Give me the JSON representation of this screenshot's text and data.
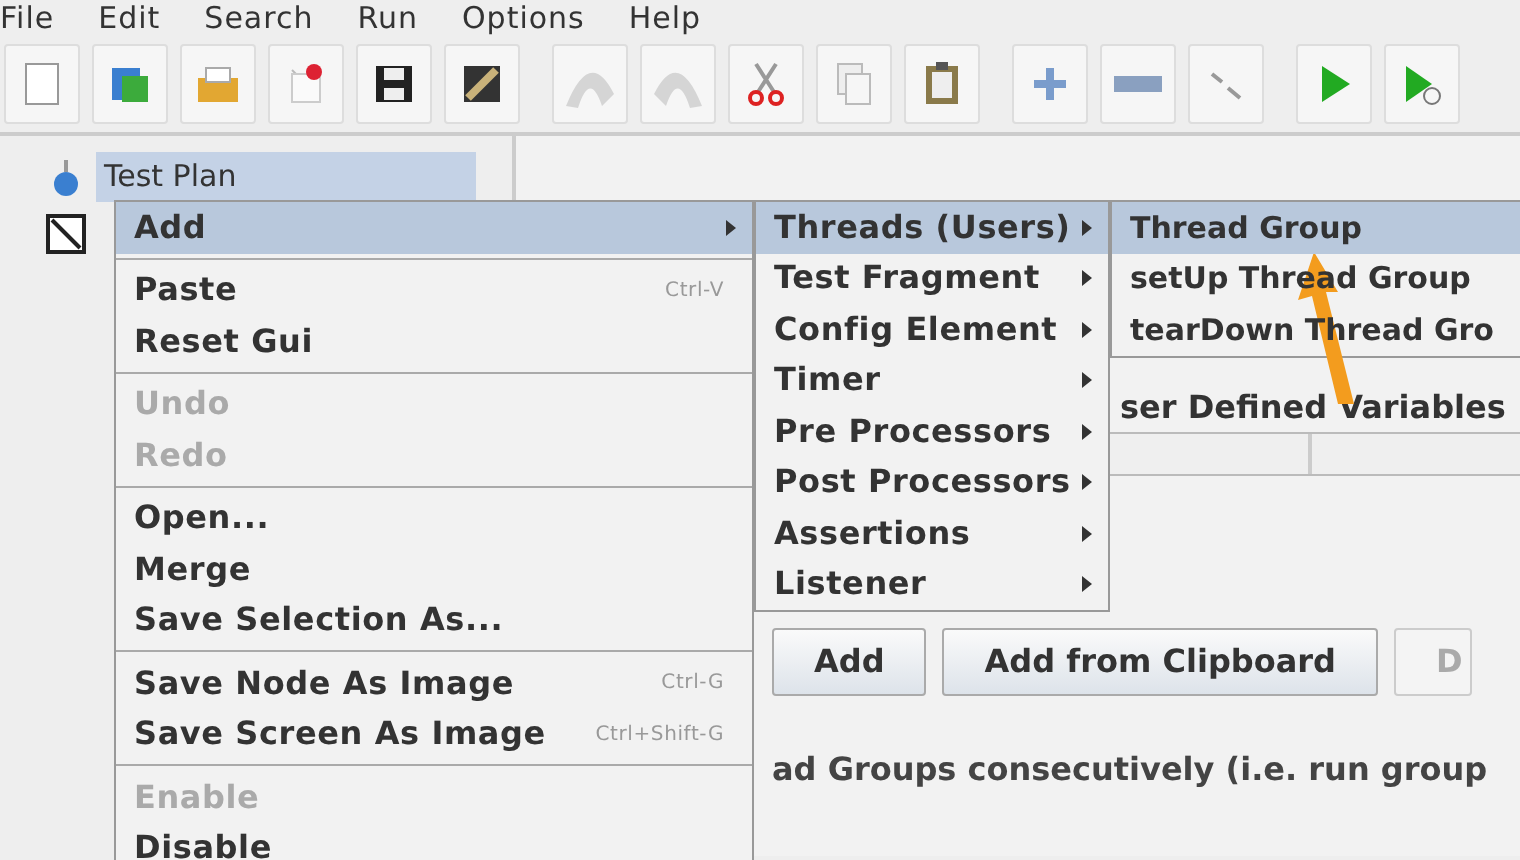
{
  "menubar": [
    "File",
    "Edit",
    "Search",
    "Run",
    "Options",
    "Help"
  ],
  "toolbar": [
    {
      "kind": "new",
      "disabled": false
    },
    {
      "kind": "templates",
      "disabled": false
    },
    {
      "kind": "open",
      "disabled": false
    },
    {
      "kind": "close",
      "disabled": false
    },
    {
      "kind": "save",
      "disabled": false
    },
    {
      "kind": "save-as",
      "disabled": false
    },
    {
      "kind": "undo",
      "disabled": true
    },
    {
      "kind": "redo",
      "disabled": true
    },
    {
      "kind": "cut",
      "disabled": false
    },
    {
      "kind": "copy",
      "disabled": false
    },
    {
      "kind": "paste",
      "disabled": false
    },
    {
      "kind": "expand",
      "disabled": false
    },
    {
      "kind": "collapse",
      "disabled": false
    },
    {
      "kind": "toggle",
      "disabled": false
    },
    {
      "kind": "start",
      "disabled": false
    },
    {
      "kind": "start-no-pause",
      "disabled": false
    }
  ],
  "tree": [
    {
      "label": "Test Plan",
      "selected": true
    }
  ],
  "panel": {
    "variables_label": "ser Defined Variables",
    "buttons": [
      {
        "label": "Add",
        "disabled": false
      },
      {
        "label": "Add from Clipboard",
        "disabled": false
      },
      {
        "label": "D",
        "disabled": true
      }
    ],
    "lines": [
      "ad Groups consecutively (i.e. run group"
    ]
  },
  "context_menu": [
    {
      "kind": "item",
      "label": "Add",
      "selected": true,
      "disabled": false,
      "submenu": true
    },
    {
      "kind": "separator"
    },
    {
      "kind": "item",
      "label": "Paste",
      "shortcut": "Ctrl-V",
      "selected": false,
      "disabled": false,
      "submenu": false
    },
    {
      "kind": "item",
      "label": "Reset Gui",
      "selected": false,
      "disabled": false,
      "submenu": false
    },
    {
      "kind": "separator"
    },
    {
      "kind": "item",
      "label": "Undo",
      "selected": false,
      "disabled": true,
      "submenu": false
    },
    {
      "kind": "item",
      "label": "Redo",
      "selected": false,
      "disabled": true,
      "submenu": false
    },
    {
      "kind": "separator"
    },
    {
      "kind": "item",
      "label": "Open...",
      "selected": false,
      "disabled": false,
      "submenu": false
    },
    {
      "kind": "item",
      "label": "Merge",
      "selected": false,
      "disabled": false,
      "submenu": false
    },
    {
      "kind": "item",
      "label": "Save Selection As...",
      "selected": false,
      "disabled": false,
      "submenu": false
    },
    {
      "kind": "separator"
    },
    {
      "kind": "item",
      "label": "Save Node As Image",
      "shortcut": "Ctrl-G",
      "selected": false,
      "disabled": false,
      "submenu": false
    },
    {
      "kind": "item",
      "label": "Save Screen As Image",
      "shortcut": "Ctrl+Shift-G",
      "selected": false,
      "disabled": false,
      "submenu": false
    },
    {
      "kind": "separator"
    },
    {
      "kind": "item",
      "label": "Enable",
      "selected": false,
      "disabled": true,
      "submenu": false
    },
    {
      "kind": "item",
      "label": "Disable",
      "selected": false,
      "disabled": false,
      "submenu": false
    }
  ],
  "add_submenu": [
    {
      "label": "Threads (Users)",
      "selected": true,
      "submenu": true
    },
    {
      "label": "Test Fragment",
      "selected": false,
      "submenu": true
    },
    {
      "label": "Config Element",
      "selected": false,
      "submenu": true
    },
    {
      "label": "Timer",
      "selected": false,
      "submenu": true
    },
    {
      "label": "Pre Processors",
      "selected": false,
      "submenu": true
    },
    {
      "label": "Post Processors",
      "selected": false,
      "submenu": true
    },
    {
      "label": "Assertions",
      "selected": false,
      "submenu": true
    },
    {
      "label": "Listener",
      "selected": false,
      "submenu": true
    }
  ],
  "threads_submenu": [
    {
      "label": "Thread Group",
      "selected": true
    },
    {
      "label": "setUp Thread Group",
      "selected": false
    },
    {
      "label": "tearDown Thread Gro",
      "selected": false
    }
  ]
}
